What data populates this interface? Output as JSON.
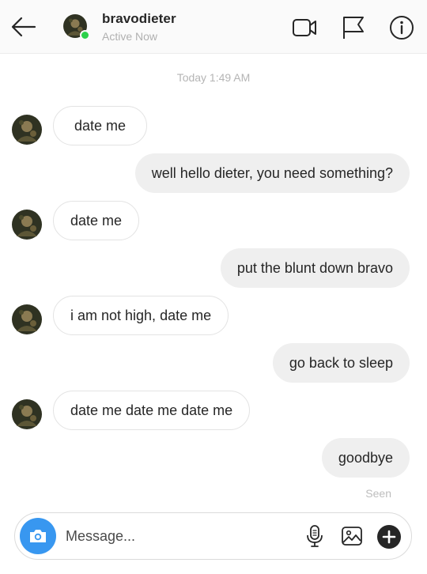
{
  "header": {
    "username": "bravodieter",
    "status": "Active Now",
    "icons": {
      "back": "arrow-left-icon",
      "video": "video-camera-icon",
      "flag": "flag-icon",
      "info": "info-icon"
    },
    "online_color": "#2bd14a"
  },
  "thread": {
    "timestamp": "Today 1:49 AM",
    "messages": [
      {
        "from": "them",
        "text": "date me"
      },
      {
        "from": "me",
        "text": "well hello dieter, you need something?"
      },
      {
        "from": "them",
        "text": "date me"
      },
      {
        "from": "me",
        "text": "put the blunt down bravo"
      },
      {
        "from": "them",
        "text": "i am not high, date me"
      },
      {
        "from": "me",
        "text": "go back to sleep"
      },
      {
        "from": "them",
        "text": "date me date me date me"
      },
      {
        "from": "me",
        "text": "goodbye"
      }
    ],
    "seen_label": "Seen"
  },
  "composer": {
    "placeholder": "Message...",
    "icons": {
      "camera": "camera-icon",
      "mic": "microphone-icon",
      "gallery": "image-icon",
      "plus": "plus-circle-icon"
    },
    "accent": "#3897f0"
  }
}
